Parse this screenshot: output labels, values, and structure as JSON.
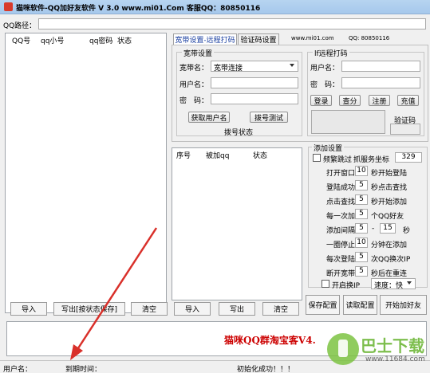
{
  "window": {
    "title": "猫咪软件-QQ加好友软件 V 3.0 www.mi01.Com 客服QQ：80850116"
  },
  "qq_path": {
    "label": "QQ路径：",
    "value": ""
  },
  "left_list": {
    "columns": [
      "QQ号",
      "qq小号",
      "qq密码",
      "状态"
    ]
  },
  "tabs": [
    {
      "label": "宽带设置-远程打码"
    },
    {
      "label": "验证码设置"
    }
  ],
  "site_text": "www.mi01.com",
  "qq_text": "QQ: 80850116",
  "broadband": {
    "group_title": "宽带设置",
    "name_label": "宽带名：",
    "name_value": "宽带连接",
    "user_label": "用户名：",
    "user_value": "",
    "pass_label": "密　码：",
    "pass_value": "",
    "get_user_btn": "获取用户名",
    "dial_test_btn": "拨号测试",
    "dial_status": "拨号状态"
  },
  "remote": {
    "group_title": "lf远程打码",
    "user_label": "用户名：",
    "user_value": "",
    "pass_label": "密　码：",
    "pass_value": "",
    "login_btn": "登录",
    "check_btn": "查分",
    "register_btn": "注册",
    "recharge_btn": "充值",
    "captcha_label": "验证码"
  },
  "friend_list": {
    "columns": [
      "序号",
      "被加qq",
      "状态"
    ]
  },
  "add_settings": {
    "group_title": "添加设置",
    "frequent_skip": "频繁跳过",
    "coord_label": "抓服务坐标",
    "coord_value": "329",
    "rows": [
      {
        "prefix": "打开窗口",
        "value": "10",
        "suffix": "秒开始登陆"
      },
      {
        "prefix": "登陆成功",
        "value": "5",
        "suffix": "秒点击查找"
      },
      {
        "prefix": "点击查找",
        "value": "5",
        "suffix": "秒开始添加"
      },
      {
        "prefix": "每一次加",
        "value": "5",
        "suffix": "个QQ好友"
      },
      {
        "prefix": "一圈停止",
        "value": "10",
        "suffix": "分钟在添加"
      },
      {
        "prefix": "每次登陆",
        "value": "5",
        "suffix": "次QQ换次IP"
      },
      {
        "prefix": "断开宽带",
        "value": "5",
        "suffix": "秒后在重连"
      }
    ],
    "interval_label": "添加间隔",
    "interval_min": "5",
    "interval_dash": "-",
    "interval_max": "15",
    "interval_unit": "秒",
    "ip_switch": "开启换IP",
    "speed_label": "速度：快"
  },
  "bottom_buttons": {
    "import1": "导入",
    "export_status": "写出[按状态保存]",
    "clear1": "清空",
    "import2": "导入",
    "export2": "写出",
    "clear2": "清空",
    "save_config": "保存配置",
    "load_config": "读取配置",
    "start": "开始加好友"
  },
  "banner_text": "猫咪QQ群淘宝客V4.",
  "status_bar": {
    "user": "用户名：",
    "expire": "到期时间：",
    "init": "初始化成功！！！"
  },
  "watermark": {
    "brand": "巴士下载",
    "url": "www.11684.com"
  },
  "colors": {
    "banner_red": "#cc0000",
    "arrow_red": "#d9302a",
    "title_bg": "#a6c8ec"
  }
}
